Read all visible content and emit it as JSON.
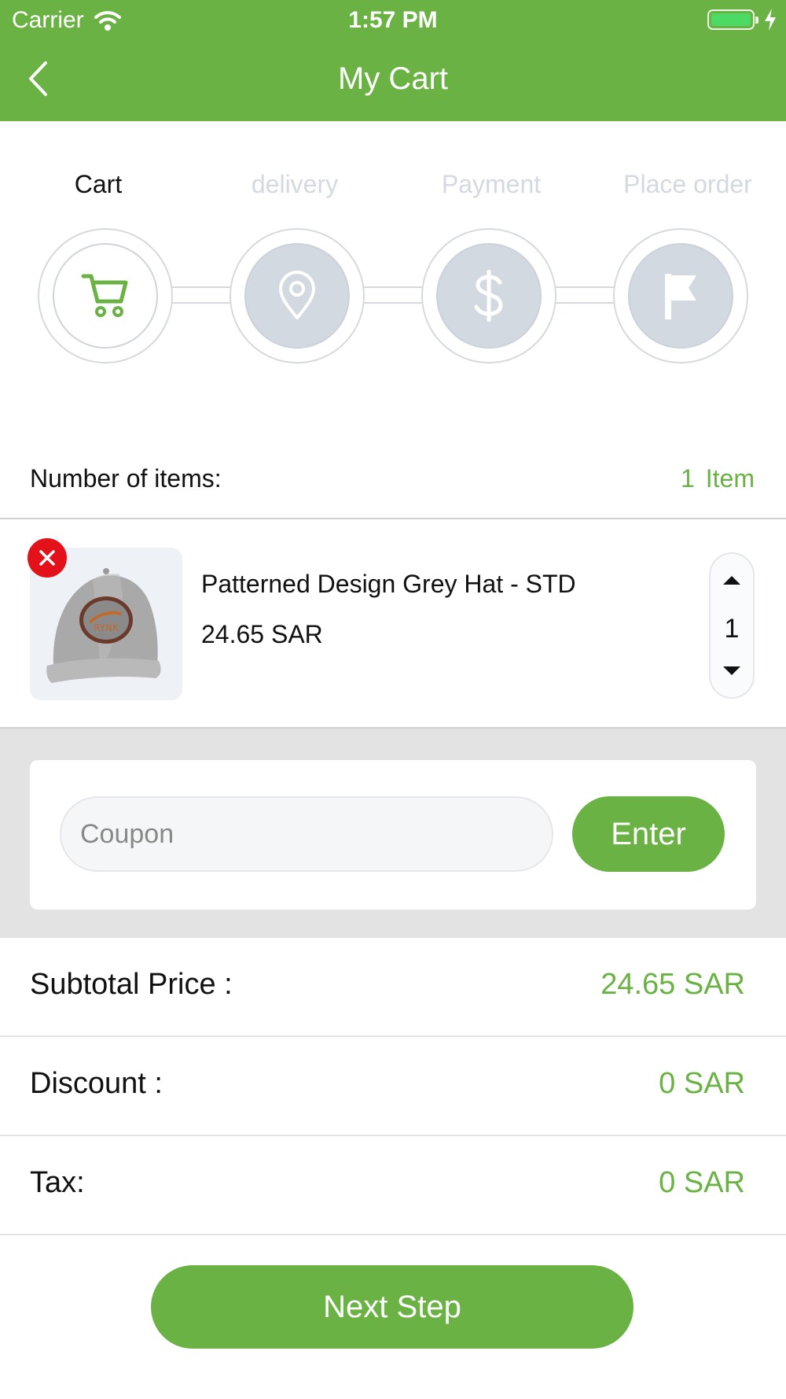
{
  "status_bar": {
    "carrier": "Carrier",
    "time": "1:57 PM"
  },
  "nav": {
    "title": "My Cart"
  },
  "steps": [
    {
      "label": "Cart",
      "icon": "cart-icon",
      "active": true
    },
    {
      "label": "delivery",
      "icon": "location-pin-icon",
      "active": false
    },
    {
      "label": "Payment",
      "icon": "dollar-icon",
      "active": false
    },
    {
      "label": "Place order",
      "icon": "flag-icon",
      "active": false
    }
  ],
  "items_count": {
    "label": "Number of items:",
    "count": "1",
    "unit": "Item"
  },
  "cart_item": {
    "name": "Patterned Design Grey Hat - STD",
    "price": "24.65 SAR",
    "quantity": "1",
    "image_icon": "grey-cap-icon"
  },
  "coupon": {
    "placeholder": "Coupon",
    "value": "",
    "button_label": "Enter"
  },
  "totals": {
    "subtotal_label": "Subtotal Price :",
    "subtotal_value": "24.65 SAR",
    "discount_label": "Discount :",
    "discount_value": "0 SAR",
    "tax_label": "Tax:",
    "tax_value": "0 SAR"
  },
  "next_button": {
    "label": "Next Step"
  },
  "colors": {
    "brand": "#6ab244",
    "inactive": "#d3d9e0",
    "remove": "#e3111a"
  }
}
